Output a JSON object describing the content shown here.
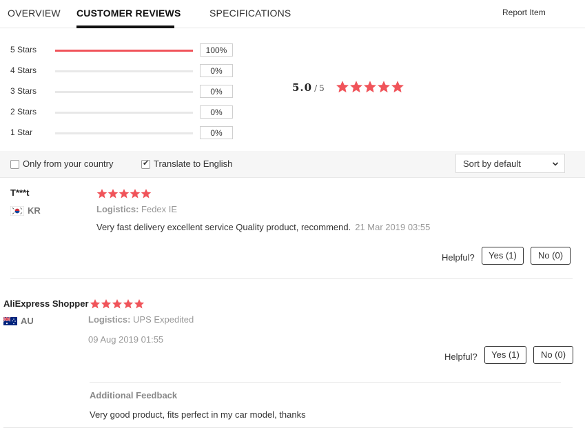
{
  "tabs": {
    "overview": "OVERVIEW",
    "reviews": "CUSTOMER REVIEWS",
    "specs": "SPECIFICATIONS",
    "report": "Report Item"
  },
  "ratings": [
    {
      "label": "5 Stars",
      "percent": "100%",
      "fraction": 1.0
    },
    {
      "label": "4 Stars",
      "percent": "0%",
      "fraction": 0
    },
    {
      "label": "3 Stars",
      "percent": "0%",
      "fraction": 0
    },
    {
      "label": "2 Stars",
      "percent": "0%",
      "fraction": 0
    },
    {
      "label": "1 Star",
      "percent": "0%",
      "fraction": 0
    }
  ],
  "average": {
    "value": "5.0",
    "separator": "/",
    "max": "5",
    "stars": 5
  },
  "filters": {
    "only_country": {
      "label": "Only from your country",
      "checked": false
    },
    "translate": {
      "label": "Translate to English",
      "checked": true
    },
    "sort": {
      "selected": "Sort by default"
    }
  },
  "colors": {
    "accent": "#f0545a",
    "star": "#f0545a"
  },
  "reviews": [
    {
      "name": "T***t",
      "country": "KR",
      "flag_icon": "flag-kr-icon",
      "stars": 5,
      "logistics_label": "Logistics:",
      "logistics_value": "Fedex IE",
      "text": "Very fast delivery excellent service Quality product, recommend.",
      "date": "21 Mar 2019 03:55",
      "helpful": "Helpful?",
      "yes": "Yes (1)",
      "no": "No (0)"
    },
    {
      "name": "AliExpress Shopper",
      "country": "AU",
      "flag_icon": "flag-au-icon",
      "stars": 5,
      "logistics_label": "Logistics:",
      "logistics_value": "UPS Expedited",
      "date": "09 Aug 2019 01:55",
      "helpful": "Helpful?",
      "yes": "Yes (1)",
      "no": "No (0)",
      "additional_title": "Additional Feedback",
      "additional_text": "Very good product, fits perfect in my car model, thanks"
    }
  ]
}
